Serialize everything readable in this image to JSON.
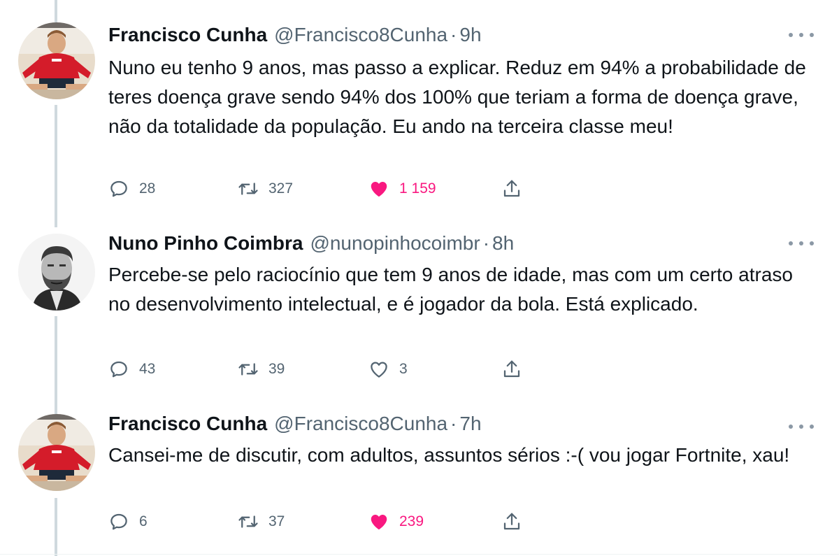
{
  "tweets": [
    {
      "name": "Francisco Cunha",
      "handle": "@Francisco8Cunha",
      "dot": "·",
      "time": "9h",
      "text": "Nuno eu tenho 9 anos, mas passo a explicar. Reduz em 94% a probabilidade de teres doença grave sendo 94% dos 100% que teriam a forma de doença grave, não da totalidade da população. Eu ando na terceira classe meu!",
      "replies": "28",
      "retweets": "327",
      "likes": "1 159",
      "liked": true,
      "avatar": "boy-red-shirt"
    },
    {
      "name": "Nuno Pinho Coimbra",
      "handle": "@nunopinhocoimbr",
      "dot": "·",
      "time": "8h",
      "text": "Percebe-se pelo raciocínio que tem 9 anos de idade, mas com um certo atraso no desenvolvimento intelectual, e é jogador da bola. Está explicado.",
      "replies": "43",
      "retweets": "39",
      "likes": "3",
      "liked": false,
      "avatar": "bearded-man-bw"
    },
    {
      "name": "Francisco Cunha",
      "handle": "@Francisco8Cunha",
      "dot": "·",
      "time": "7h",
      "text": "Cansei-me de discutir, com adultos, assuntos sérios :-( vou jogar Fortnite, xau!",
      "replies": "6",
      "retweets": "37",
      "likes": "239",
      "liked": true,
      "avatar": "boy-red-shirt"
    }
  ],
  "icons": {
    "reply": "reply-icon",
    "retweet": "retweet-icon",
    "like": "heart-icon",
    "share": "share-icon",
    "more": "more-icon"
  },
  "colors": {
    "like_active": "#f91880",
    "secondary_text": "#536471",
    "primary_text": "#0f1419",
    "thread_line": "#cfd9de"
  }
}
